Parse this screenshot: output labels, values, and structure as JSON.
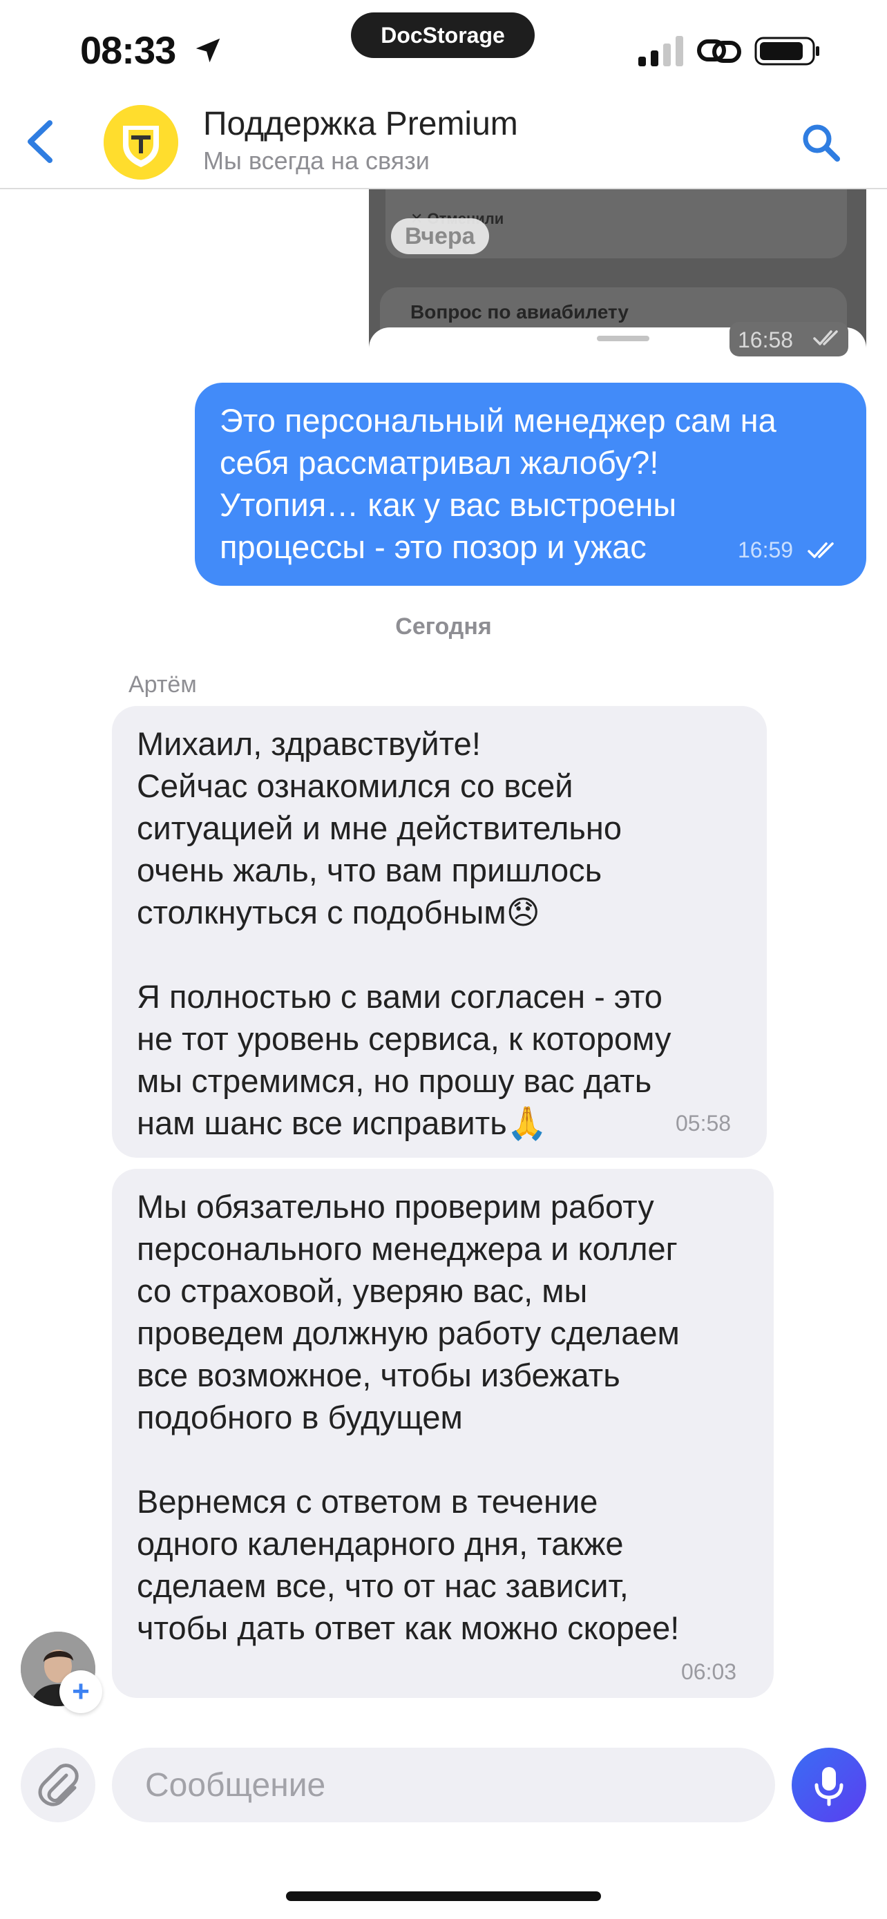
{
  "status_bar": {
    "time": "08:33",
    "center_label": "DocStorage",
    "icons": [
      "location-arrow-icon",
      "signal-icon",
      "link-icon",
      "battery-icon"
    ]
  },
  "header": {
    "title": "Поддержка Premium",
    "subtitle": "Мы всегда на связи",
    "icons": [
      "back-chevron-icon",
      "bank-logo",
      "search-icon"
    ]
  },
  "quoted_image": {
    "card1_text": "✕ Отменили",
    "card2_text": "Вопрос по авиабилету",
    "date_label": "Вчера",
    "time": "16:58"
  },
  "outgoing_message": {
    "text": "Это персональный менеджер сам на\nсебя рассматривал жалобу?!\nУтопия… как у вас выстроены\nпроцессы - это позор и ужас",
    "time": "16:59",
    "status": "read"
  },
  "day_separator": "Сегодня",
  "incoming": {
    "sender": "Артём",
    "messages": [
      {
        "text": "Михаил, здравствуйте!\nСейчас ознакомился со всей\nситуацией и мне действительно\nочень жаль, что вам пришлось\nстолкнуться с подобным😞\n\nЯ полностью с вами согласен - это\nне тот уровень сервиса, к которому\nмы стремимся, но прошу вас дать\nнам шанс все исправить🙏",
        "time": "05:58"
      },
      {
        "text": "Мы обязательно проверим работу\nперсонального менеджера и коллег\nсо страховой, уверяю вас, мы\nпроведем должную работу сделаем\nвсе возможное, чтобы избежать\nподобного в будущем\n\nВернемся с ответом в течение\nодного календарного дня, также\nсделаем все, что от нас зависит,\nчтобы дать ответ как можно скорее!",
        "time": "06:03"
      }
    ]
  },
  "input_bar": {
    "placeholder": "Сообщение",
    "value": "",
    "icons": [
      "paperclip-icon",
      "microphone-icon"
    ]
  },
  "colors": {
    "accent": "#2f7de1",
    "outgoing_bubble": "#428bf9",
    "incoming_bubble": "#efeff4",
    "mic_gradient_start": "#3a6df4",
    "mic_gradient_end": "#5a3ff0",
    "logo_yellow": "#ffdd2d"
  }
}
